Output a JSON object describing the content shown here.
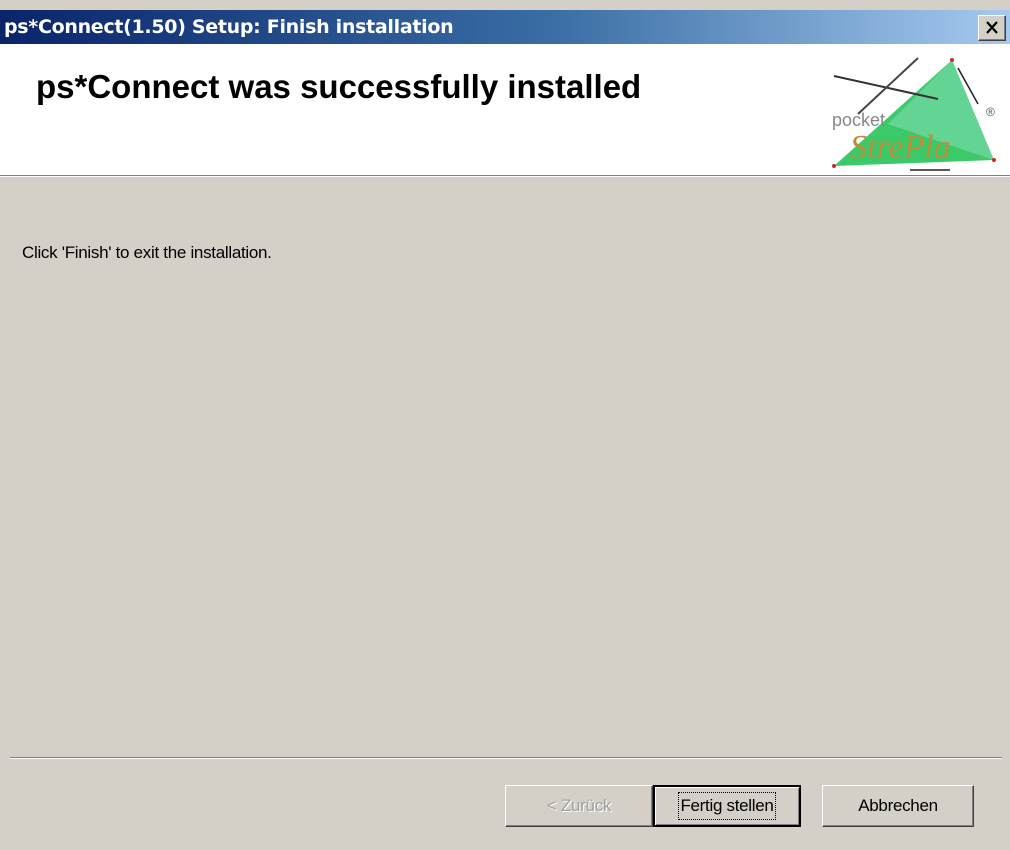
{
  "window": {
    "title": "ps*Connect(1.50) Setup: Finish installation",
    "close_glyph": "✕"
  },
  "header": {
    "heading": "ps*Connect was successfully installed",
    "logo": {
      "icon": "pocket-strepla-logo",
      "text_small": "pocket",
      "text_large": "StrePla",
      "registered_mark": "®"
    }
  },
  "body": {
    "message": "Click  'Finish' to exit the installation."
  },
  "buttons": {
    "back_label": "< Zurück",
    "finish_label": "Fertig stellen",
    "cancel_label": "Abbrechen"
  }
}
